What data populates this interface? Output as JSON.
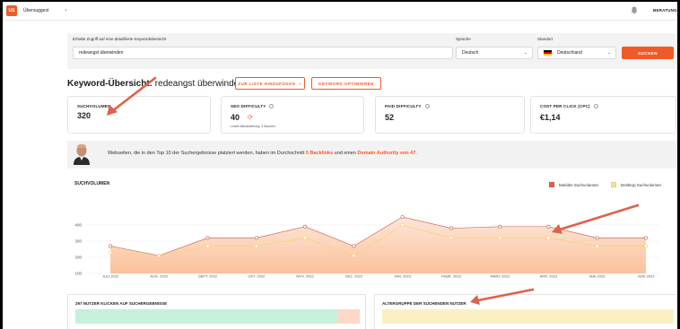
{
  "app": {
    "logo": "US",
    "name": "Übersuggest",
    "chevron": "›",
    "right_link": "BERATUNG"
  },
  "search": {
    "prompt": "Erhalte Zugriff auf eine detaillierte Keywordübersicht",
    "keyword": "redeangst überwinden",
    "language_label": "Sprache",
    "language": "Deutsch",
    "location_label": "Standort",
    "location": "Deutschland",
    "button": "SUCHEN"
  },
  "overview": {
    "title_bold": "Keyword-Übersicht:",
    "title_keyword": "redeangst überwinden",
    "add_list_button": "ZUR LISTE HINZUFÜGEN",
    "optimize_button": "KEYWORD OPTIMIEREN"
  },
  "cards": [
    {
      "label": "SUCHVOLUMEN",
      "value": "320"
    },
    {
      "label": "SEO DIFFICULTY",
      "value": "40",
      "sub": "Letzte Aktualisierung: 3 Wochen"
    },
    {
      "label": "PAID DIFFICULTY",
      "value": "52"
    },
    {
      "label": "COST PER CLICK (CPC)",
      "value": "€1,14"
    }
  ],
  "banner": {
    "text_before": "Webseiten, die in den Top 10 der Suchergebnisse platziert werden, haben im Durchschnitt",
    "backlinks": "5 Backlinks",
    "text_mid": "und einen",
    "authority": "Domain Authority von 47",
    "text_end": "."
  },
  "chart_data": {
    "type": "area",
    "title": "SUCHVOLUMEN",
    "categories": [
      "JULI 2022",
      "AUG. 2022",
      "SEPT. 2022",
      "OKT. 2022",
      "NOV. 2022",
      "DEZ. 2022",
      "JAN. 2023",
      "FEBR. 2023",
      "MÄRZ 2023",
      "APR. 2023",
      "MAI 2023",
      "JUNI 2023"
    ],
    "series": [
      {
        "name": "Mobiles Suchvolumen",
        "color": "#c9705c",
        "values": [
          270,
          210,
          320,
          320,
          390,
          270,
          450,
          380,
          390,
          390,
          320,
          320
        ]
      },
      {
        "name": "Desktop Suchvolumen",
        "color": "#f5d27a",
        "values": [
          230,
          210,
          270,
          270,
          320,
          210,
          400,
          320,
          320,
          320,
          270,
          270
        ]
      }
    ],
    "yticks": [
      100,
      200,
      300,
      400
    ],
    "ylim": [
      100,
      500
    ],
    "legend_position": "top-right",
    "grid": true
  },
  "bottom": {
    "clicks_title": "297 NUTZER KLICKEN AUF SUCHERGEBNISSE",
    "clicks_mobile_fraction": 0.92,
    "age_title": "ALTERGRUPPE DER SUCHENDEN NUTZER"
  },
  "colors": {
    "accent": "#f05a28",
    "arrow": "#e0614b"
  }
}
